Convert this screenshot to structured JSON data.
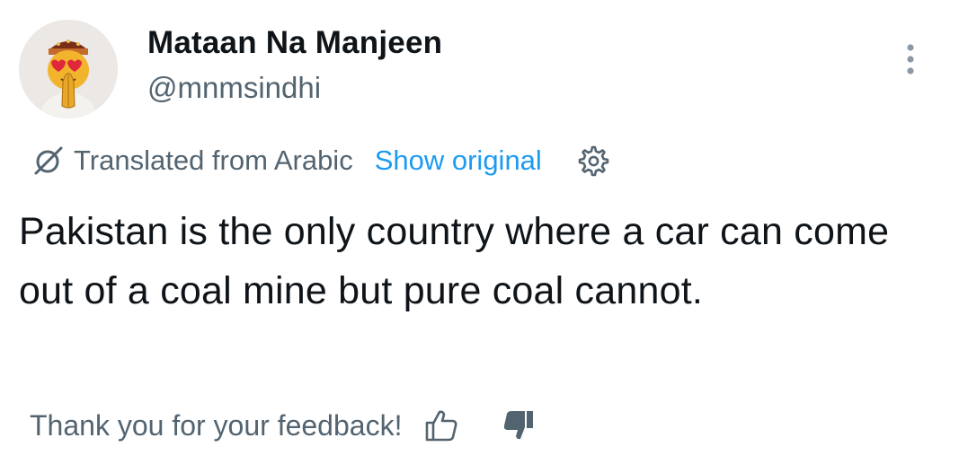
{
  "author": {
    "display_name": "Mataan Na Manjeen",
    "handle": "@mnmsindhi",
    "avatar_icon": "avatar-emoji-heart-eyes-praying-hands"
  },
  "header": {
    "more_icon": "more-vertical-icon"
  },
  "translation": {
    "icon": "globe-slash-icon",
    "label": "Translated from Arabic",
    "show_original_label": "Show original",
    "settings_icon": "gear-icon",
    "link_color": "#1d9bf0",
    "muted_color": "#536471"
  },
  "tweet": {
    "text": "Pakistan is the only country where a car can come out of a coal mine but pure coal cannot."
  },
  "feedback": {
    "label": "Thank you for your feedback!",
    "thumb_up_icon": "thumbs-up-outline-icon",
    "thumb_down_icon": "thumbs-down-filled-icon"
  }
}
